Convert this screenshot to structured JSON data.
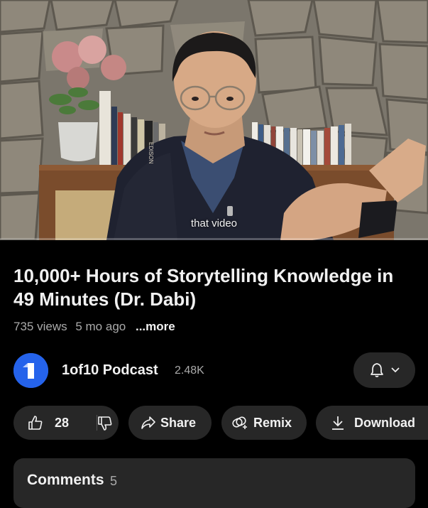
{
  "video": {
    "caption": "that video",
    "shelf_book_spine": "EDISON"
  },
  "title": "10,000+ Hours of Storytelling Knowledge in 49 Minutes (Dr. Dabi)",
  "meta": {
    "views": "735 views",
    "age": "5 mo ago",
    "more_label": "...more"
  },
  "channel": {
    "avatar_glyph": "1",
    "name": "1of10 Podcast",
    "subscribers": "2.48K"
  },
  "actions": {
    "like_count": "28",
    "share_label": "Share",
    "remix_label": "Remix",
    "download_label": "Download"
  },
  "comments": {
    "label": "Comments",
    "count": "5"
  },
  "icons": {
    "like": "thumbs-up-icon",
    "dislike": "thumbs-down-icon",
    "share": "share-arrow-icon",
    "remix": "remix-icon",
    "download": "download-icon",
    "bell": "bell-icon",
    "chevron": "chevron-down-icon"
  },
  "colors": {
    "background": "#000000",
    "pill": "#272727",
    "avatar": "#2563eb",
    "secondary_text": "#aaaaaa",
    "primary_text": "#f1f1f1"
  }
}
